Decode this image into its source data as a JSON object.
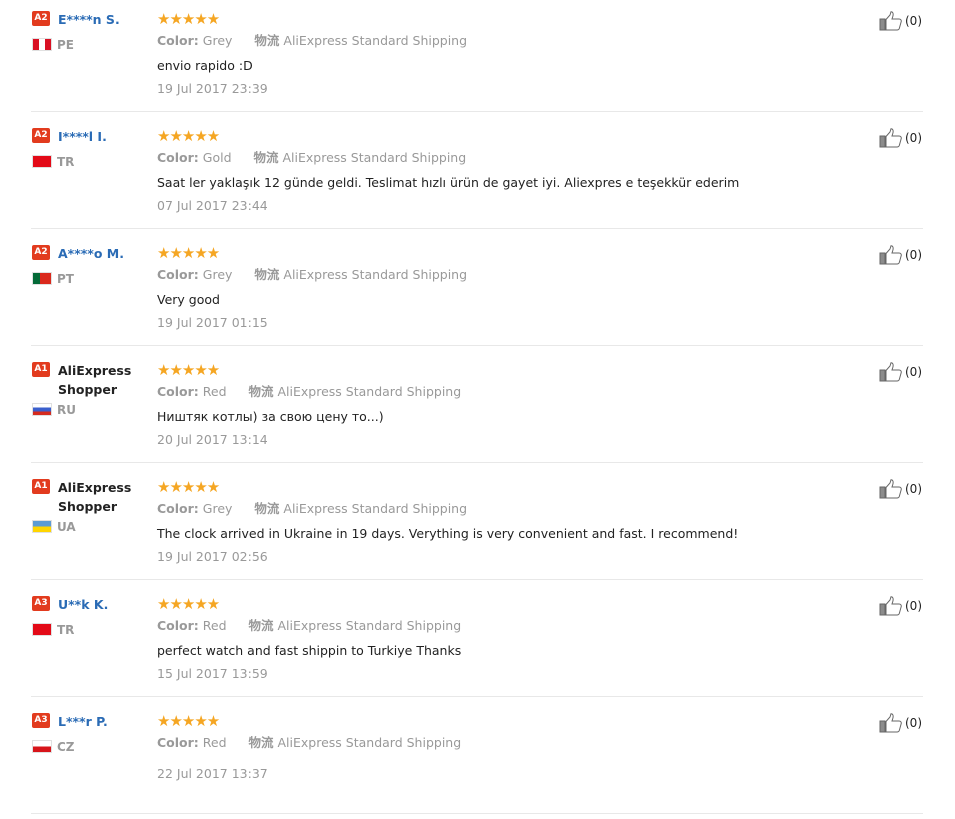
{
  "info_labels": {
    "color_label": "Color:",
    "logistics_label": "物流"
  },
  "reviews": [
    {
      "badge": "A2",
      "name": "E****n S.",
      "country": "PE",
      "flag": "pe",
      "color": "Grey",
      "shipping": "AliExpress Standard Shipping",
      "text": "envio rapido :D",
      "date": "19 Jul 2017 23:39",
      "likes": "(0)"
    },
    {
      "badge": "A2",
      "name": "I****l I.",
      "country": "TR",
      "flag": "tr",
      "color": "Gold",
      "shipping": "AliExpress Standard Shipping",
      "text": "Saat ler yaklaşık 12 günde geldi. Teslimat hızlı ürün de gayet iyi. Aliexpres e teşekkür ederim",
      "date": "07 Jul 2017 23:44",
      "likes": "(0)"
    },
    {
      "badge": "A2",
      "name": "A****o M.",
      "country": "PT",
      "flag": "pt",
      "color": "Grey",
      "shipping": "AliExpress Standard Shipping",
      "text": "Very good",
      "date": "19 Jul 2017 01:15",
      "likes": "(0)"
    },
    {
      "badge": "A1",
      "name": "AliExpress Shopper",
      "country": "RU",
      "flag": "ru",
      "color": "Red",
      "shipping": "AliExpress Standard Shipping",
      "text": "Ништяк котлы) за свою цену то...)",
      "date": "20 Jul 2017 13:14",
      "likes": "(0)"
    },
    {
      "badge": "A1",
      "name": "AliExpress Shopper",
      "country": "UA",
      "flag": "ua",
      "color": "Grey",
      "shipping": "AliExpress Standard Shipping",
      "text": "The clock arrived in Ukraine in 19 days. Verything is very convenient and fast. I recommend!",
      "date": "19 Jul 2017 02:56",
      "likes": "(0)"
    },
    {
      "badge": "A3",
      "name": "U**k K.",
      "country": "TR",
      "flag": "tr",
      "color": "Red",
      "shipping": "AliExpress Standard Shipping",
      "text": "perfect watch and fast shippin to Turkiye Thanks",
      "date": "15 Jul 2017 13:59",
      "likes": "(0)"
    },
    {
      "badge": "A3",
      "name": "L***r P.",
      "country": "CZ",
      "flag": "cz",
      "color": "Red",
      "shipping": "AliExpress Standard Shipping",
      "text": "",
      "date": "22 Jul 2017 13:37",
      "likes": "(0)"
    }
  ],
  "rating_stars": "★★★★★",
  "colors": {
    "badge": "#e23b1e",
    "username": "#2a6bb5",
    "star": "#f5a623",
    "muted": "#999999"
  }
}
